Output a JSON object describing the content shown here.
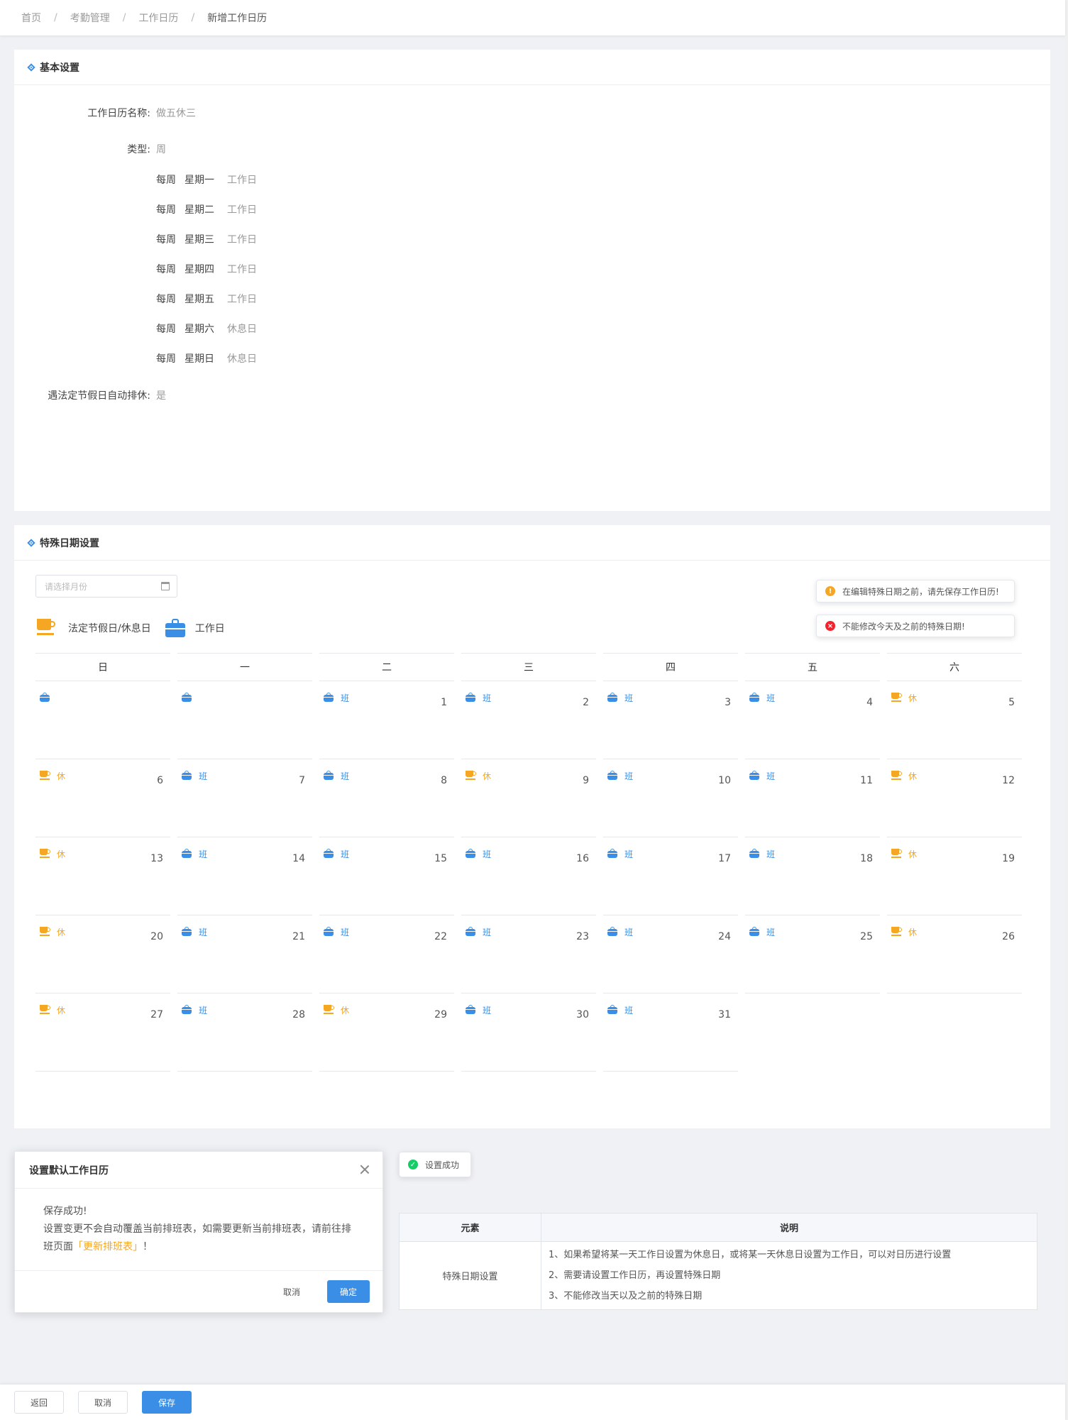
{
  "breadcrumb": [
    "首页",
    "考勤管理",
    "工作日历",
    "新增工作日历"
  ],
  "basic": {
    "title": "基本设置",
    "name_label": "工作日历名称:",
    "name_value": "做五休三",
    "type_label": "类型:",
    "type_value": "周",
    "weekdays": [
      {
        "prefix": "每周",
        "day": "星期一",
        "status": "工作日"
      },
      {
        "prefix": "每周",
        "day": "星期二",
        "status": "工作日"
      },
      {
        "prefix": "每周",
        "day": "星期三",
        "status": "工作日"
      },
      {
        "prefix": "每周",
        "day": "星期四",
        "status": "工作日"
      },
      {
        "prefix": "每周",
        "day": "星期五",
        "status": "工作日"
      },
      {
        "prefix": "每周",
        "day": "星期六",
        "status": "休息日"
      },
      {
        "prefix": "每周",
        "day": "星期日",
        "status": "休息日"
      }
    ],
    "holiday_label": "遇法定节假日自动排休:",
    "holiday_value": "是"
  },
  "special": {
    "title": "特殊日期设置",
    "month_placeholder": "请选择月份",
    "legend": {
      "rest": "法定节假日/休息日",
      "work": "工作日"
    },
    "notices": {
      "warn": "在编辑特殊日期之前，请先保存工作日历!",
      "error": "不能修改今天及之前的特殊日期!"
    },
    "week_headers": [
      "日",
      "一",
      "二",
      "三",
      "四",
      "五",
      "六"
    ],
    "work_tag": "班",
    "rest_tag": "休",
    "weeks": [
      [
        {
          "icon": "work",
          "tag": "",
          "num": ""
        },
        {
          "icon": "work",
          "tag": "",
          "num": ""
        },
        {
          "icon": "work",
          "tag": "班",
          "num": "1"
        },
        {
          "icon": "work",
          "tag": "班",
          "num": "2"
        },
        {
          "icon": "work",
          "tag": "班",
          "num": "3"
        },
        {
          "icon": "work",
          "tag": "班",
          "num": "4"
        },
        {
          "icon": "rest",
          "tag": "休",
          "num": "5"
        }
      ],
      [
        {
          "icon": "rest",
          "tag": "休",
          "num": "6"
        },
        {
          "icon": "work",
          "tag": "班",
          "num": "7"
        },
        {
          "icon": "work",
          "tag": "班",
          "num": "8"
        },
        {
          "icon": "rest",
          "tag": "休",
          "num": "9"
        },
        {
          "icon": "work",
          "tag": "班",
          "num": "10"
        },
        {
          "icon": "work",
          "tag": "班",
          "num": "11"
        },
        {
          "icon": "rest",
          "tag": "休",
          "num": "12"
        }
      ],
      [
        {
          "icon": "rest",
          "tag": "休",
          "num": "13"
        },
        {
          "icon": "work",
          "tag": "班",
          "num": "14"
        },
        {
          "icon": "work",
          "tag": "班",
          "num": "15"
        },
        {
          "icon": "work",
          "tag": "班",
          "num": "16"
        },
        {
          "icon": "work",
          "tag": "班",
          "num": "17"
        },
        {
          "icon": "work",
          "tag": "班",
          "num": "18"
        },
        {
          "icon": "rest",
          "tag": "休",
          "num": "19"
        }
      ],
      [
        {
          "icon": "rest",
          "tag": "休",
          "num": "20"
        },
        {
          "icon": "work",
          "tag": "班",
          "num": "21"
        },
        {
          "icon": "work",
          "tag": "班",
          "num": "22"
        },
        {
          "icon": "work",
          "tag": "班",
          "num": "23"
        },
        {
          "icon": "work",
          "tag": "班",
          "num": "24"
        },
        {
          "icon": "work",
          "tag": "班",
          "num": "25"
        },
        {
          "icon": "rest",
          "tag": "休",
          "num": "26"
        }
      ],
      [
        {
          "icon": "rest",
          "tag": "休",
          "num": "27"
        },
        {
          "icon": "work",
          "tag": "班",
          "num": "28"
        },
        {
          "icon": "rest",
          "tag": "休",
          "num": "29"
        },
        {
          "icon": "work",
          "tag": "班",
          "num": "30"
        },
        {
          "icon": "work",
          "tag": "班",
          "num": "31"
        },
        {
          "icon": "",
          "tag": "",
          "num": ""
        },
        {
          "icon": "",
          "tag": "",
          "num": ""
        }
      ]
    ]
  },
  "dialog": {
    "title": "设置默认工作日历",
    "line1": "保存成功!",
    "line2": "设置变更不会自动覆盖当前排班表，如需要更新当前排班表，请前往排",
    "line3_prefix": "班页面",
    "line3_link": "「更新排班表」",
    "line3_suffix": "！",
    "cancel": "取消",
    "confirm": "确定"
  },
  "toast": {
    "success": "设置成功"
  },
  "info_table": {
    "headers": [
      "元素",
      "说明"
    ],
    "element": "特殊日期设置",
    "lines": [
      "1、如果希望将某一天工作日设置为休息日，或将某一天休息日设置为工作日，可以对日历进行设置",
      "2、需要请设置工作日历，再设置特殊日期",
      "3、不能修改当天以及之前的特殊日期"
    ]
  },
  "footer": {
    "back": "返回",
    "cancel": "取消",
    "save": "保存"
  },
  "colors": {
    "primary": "#3a8ee6",
    "rest": "#f5a623",
    "error": "#f5222d",
    "success": "#13ce66"
  }
}
